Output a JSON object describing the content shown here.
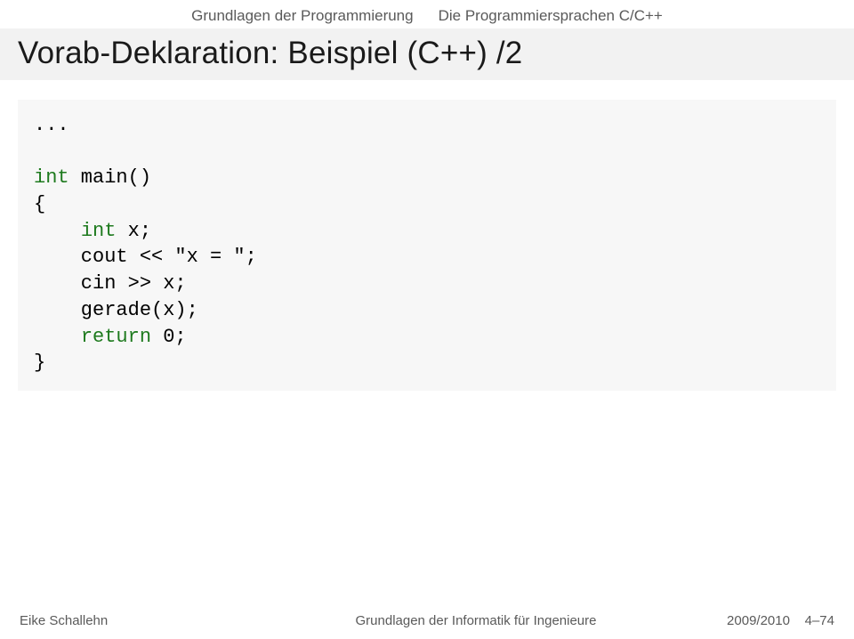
{
  "breadcrumb": {
    "left": "Grundlagen der Programmierung",
    "right": "Die Programmiersprachen C/C++"
  },
  "title": "Vorab-Deklaration: Beispiel (C++) /2",
  "code": {
    "line1": "...",
    "kw_int1": "int",
    "main_sig": " main()",
    "brace_open": "{",
    "indent": "    ",
    "kw_int2": "int",
    "decl_x": " x;",
    "cout_line": "    cout << \"x = \";",
    "cin_line": "    cin >> x;",
    "gerade_line": "    gerade(x);",
    "kw_return": "return",
    "return_tail": " 0;",
    "brace_close": "}"
  },
  "footer": {
    "author": "Eike Schallehn",
    "course": "Grundlagen der Informatik für Ingenieure",
    "term": "2009/2010",
    "page": "4–74"
  }
}
